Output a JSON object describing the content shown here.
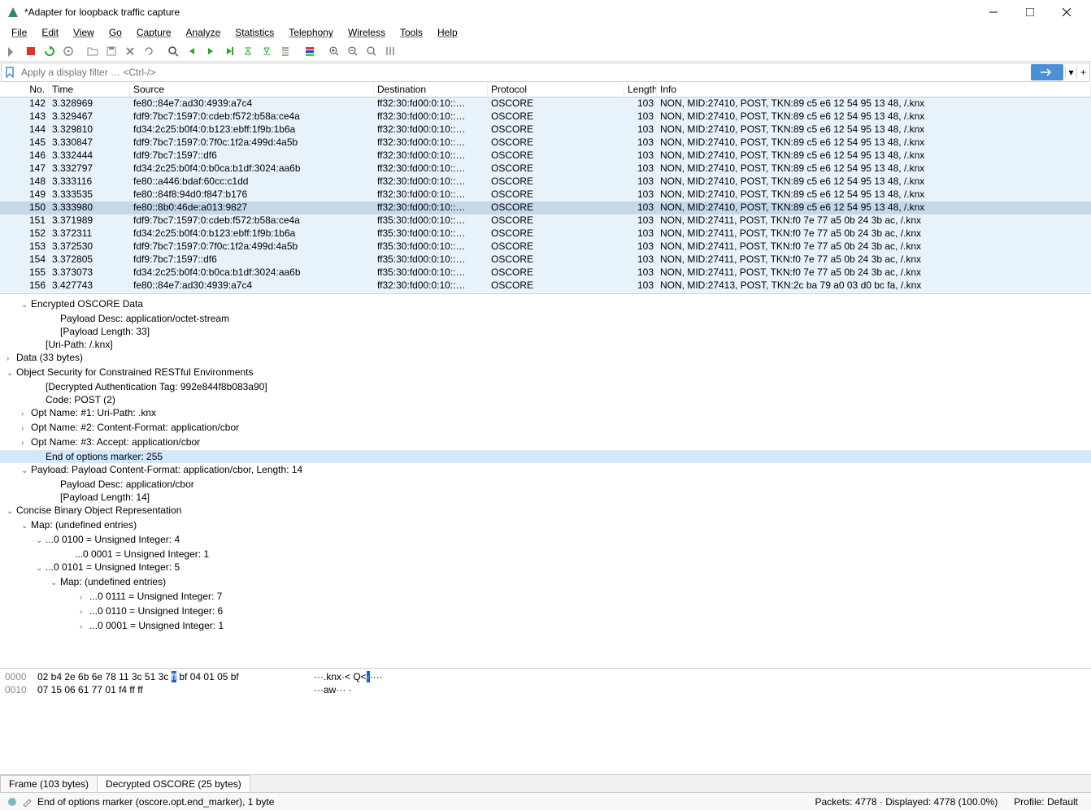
{
  "window": {
    "title": "*Adapter for loopback traffic capture"
  },
  "menu": {
    "file": "File",
    "edit": "Edit",
    "view": "View",
    "go": "Go",
    "capture": "Capture",
    "analyze": "Analyze",
    "statistics": "Statistics",
    "telephony": "Telephony",
    "wireless": "Wireless",
    "tools": "Tools",
    "help": "Help"
  },
  "filter": {
    "placeholder": "Apply a display filter … <Ctrl-/>"
  },
  "columns": {
    "no": "No.",
    "time": "Time",
    "source": "Source",
    "destination": "Destination",
    "protocol": "Protocol",
    "length": "Length",
    "info": "Info"
  },
  "packets": [
    {
      "no": "142",
      "time": "3.328969",
      "src": "fe80::84e7:ad30:4939:a7c4",
      "dst": "ff32:30:fd00:0:10::…",
      "proto": "OSCORE",
      "len": "103",
      "info": "NON, MID:27410, POST, TKN:89 c5 e6 12 54 95 13 48, /.knx"
    },
    {
      "no": "143",
      "time": "3.329467",
      "src": "fdf9:7bc7:1597:0:cdeb:f572:b58a:ce4a",
      "dst": "ff32:30:fd00:0:10::…",
      "proto": "OSCORE",
      "len": "103",
      "info": "NON, MID:27410, POST, TKN:89 c5 e6 12 54 95 13 48, /.knx"
    },
    {
      "no": "144",
      "time": "3.329810",
      "src": "fd34:2c25:b0f4:0:b123:ebff:1f9b:1b6a",
      "dst": "ff32:30:fd00:0:10::…",
      "proto": "OSCORE",
      "len": "103",
      "info": "NON, MID:27410, POST, TKN:89 c5 e6 12 54 95 13 48, /.knx"
    },
    {
      "no": "145",
      "time": "3.330847",
      "src": "fdf9:7bc7:1597:0:7f0c:1f2a:499d:4a5b",
      "dst": "ff32:30:fd00:0:10::…",
      "proto": "OSCORE",
      "len": "103",
      "info": "NON, MID:27410, POST, TKN:89 c5 e6 12 54 95 13 48, /.knx"
    },
    {
      "no": "146",
      "time": "3.332444",
      "src": "fdf9:7bc7:1597::df6",
      "dst": "ff32:30:fd00:0:10::…",
      "proto": "OSCORE",
      "len": "103",
      "info": "NON, MID:27410, POST, TKN:89 c5 e6 12 54 95 13 48, /.knx"
    },
    {
      "no": "147",
      "time": "3.332797",
      "src": "fd34:2c25:b0f4:0:b0ca:b1df:3024:aa6b",
      "dst": "ff32:30:fd00:0:10::…",
      "proto": "OSCORE",
      "len": "103",
      "info": "NON, MID:27410, POST, TKN:89 c5 e6 12 54 95 13 48, /.knx"
    },
    {
      "no": "148",
      "time": "3.333116",
      "src": "fe80::a446:bdaf:60cc:c1dd",
      "dst": "ff32:30:fd00:0:10::…",
      "proto": "OSCORE",
      "len": "103",
      "info": "NON, MID:27410, POST, TKN:89 c5 e6 12 54 95 13 48, /.knx"
    },
    {
      "no": "149",
      "time": "3.333535",
      "src": "fe80::84f8:94d0:f847:b176",
      "dst": "ff32:30:fd00:0:10::…",
      "proto": "OSCORE",
      "len": "103",
      "info": "NON, MID:27410, POST, TKN:89 c5 e6 12 54 95 13 48, /.knx"
    },
    {
      "no": "150",
      "time": "3.333980",
      "src": "fe80::8b0:46de:a013:9827",
      "dst": "ff32:30:fd00:0:10::…",
      "proto": "OSCORE",
      "len": "103",
      "info": "NON, MID:27410, POST, TKN:89 c5 e6 12 54 95 13 48, /.knx",
      "selected": true
    },
    {
      "no": "151",
      "time": "3.371989",
      "src": "fdf9:7bc7:1597:0:cdeb:f572:b58a:ce4a",
      "dst": "ff35:30:fd00:0:10::…",
      "proto": "OSCORE",
      "len": "103",
      "info": "NON, MID:27411, POST, TKN:f0 7e 77 a5 0b 24 3b ac, /.knx"
    },
    {
      "no": "152",
      "time": "3.372311",
      "src": "fd34:2c25:b0f4:0:b123:ebff:1f9b:1b6a",
      "dst": "ff35:30:fd00:0:10::…",
      "proto": "OSCORE",
      "len": "103",
      "info": "NON, MID:27411, POST, TKN:f0 7e 77 a5 0b 24 3b ac, /.knx"
    },
    {
      "no": "153",
      "time": "3.372530",
      "src": "fdf9:7bc7:1597:0:7f0c:1f2a:499d:4a5b",
      "dst": "ff35:30:fd00:0:10::…",
      "proto": "OSCORE",
      "len": "103",
      "info": "NON, MID:27411, POST, TKN:f0 7e 77 a5 0b 24 3b ac, /.knx"
    },
    {
      "no": "154",
      "time": "3.372805",
      "src": "fdf9:7bc7:1597::df6",
      "dst": "ff35:30:fd00:0:10::…",
      "proto": "OSCORE",
      "len": "103",
      "info": "NON, MID:27411, POST, TKN:f0 7e 77 a5 0b 24 3b ac, /.knx"
    },
    {
      "no": "155",
      "time": "3.373073",
      "src": "fd34:2c25:b0f4:0:b0ca:b1df:3024:aa6b",
      "dst": "ff35:30:fd00:0:10::…",
      "proto": "OSCORE",
      "len": "103",
      "info": "NON, MID:27411, POST, TKN:f0 7e 77 a5 0b 24 3b ac, /.knx"
    },
    {
      "no": "156",
      "time": "3.427743",
      "src": "fe80::84e7:ad30:4939:a7c4",
      "dst": "ff32:30:fd00:0:10::…",
      "proto": "OSCORE",
      "len": "103",
      "info": "NON, MID:27413, POST, TKN:2c ba 79 a0 03 d0 bc fa, /.knx"
    }
  ],
  "details": [
    {
      "indent": 1,
      "toggle": "v",
      "text": "Encrypted OSCORE Data"
    },
    {
      "indent": 3,
      "toggle": "",
      "text": "Payload Desc: application/octet-stream"
    },
    {
      "indent": 3,
      "toggle": "",
      "text": "[Payload Length: 33]"
    },
    {
      "indent": 2,
      "toggle": "",
      "text": "[Uri-Path: /.knx]"
    },
    {
      "indent": 0,
      "toggle": ">",
      "text": "Data (33 bytes)"
    },
    {
      "indent": 0,
      "toggle": "v",
      "text": "Object Security for Constrained RESTful Environments"
    },
    {
      "indent": 2,
      "toggle": "",
      "text": "[Decrypted Authentication Tag: 992e844f8b083a90]"
    },
    {
      "indent": 2,
      "toggle": "",
      "text": "Code: POST (2)"
    },
    {
      "indent": 1,
      "toggle": ">",
      "text": "Opt Name: #1: Uri-Path: .knx"
    },
    {
      "indent": 1,
      "toggle": ">",
      "text": "Opt Name: #2: Content-Format: application/cbor"
    },
    {
      "indent": 1,
      "toggle": ">",
      "text": "Opt Name: #3: Accept: application/cbor"
    },
    {
      "indent": 2,
      "toggle": "",
      "text": "End of options marker: 255",
      "hl": true
    },
    {
      "indent": 1,
      "toggle": "v",
      "text": "Payload: Payload Content-Format: application/cbor, Length: 14"
    },
    {
      "indent": 3,
      "toggle": "",
      "text": "Payload Desc: application/cbor"
    },
    {
      "indent": 3,
      "toggle": "",
      "text": "[Payload Length: 14]"
    },
    {
      "indent": 0,
      "toggle": "v",
      "text": "Concise Binary Object Representation"
    },
    {
      "indent": 1,
      "toggle": "v",
      "text": "Map: (undefined entries)"
    },
    {
      "indent": 2,
      "toggle": "v",
      "text": "...0 0100 = Unsigned Integer: 4"
    },
    {
      "indent": 4,
      "toggle": "",
      "text": "...0 0001 = Unsigned Integer: 1"
    },
    {
      "indent": 2,
      "toggle": "v",
      "text": "...0 0101 = Unsigned Integer: 5"
    },
    {
      "indent": 3,
      "toggle": "v",
      "text": "Map: (undefined entries)"
    },
    {
      "indent": 5,
      "toggle": ">",
      "text": "...0 0111 = Unsigned Integer: 7"
    },
    {
      "indent": 5,
      "toggle": ">",
      "text": "...0 0110 = Unsigned Integer: 6"
    },
    {
      "indent": 5,
      "toggle": ">",
      "text": "...0 0001 = Unsigned Integer: 1"
    }
  ],
  "hex": {
    "rows": [
      {
        "offset": "0000",
        "bytes_pre": "02 b4 2e 6b 6e 78 11 3c  51 3c ",
        "bytes_hl": "ff",
        "bytes_post": " bf 04 01 05 bf",
        "ascii_pre": "···.knx·< Q<",
        "ascii_hl": "·",
        "ascii_post": "····"
      },
      {
        "offset": "0010",
        "bytes_pre": "07 15 06 61 77 01 f4 ff  ff",
        "bytes_hl": "",
        "bytes_post": "",
        "ascii_pre": "···aw··· ·",
        "ascii_hl": "",
        "ascii_post": ""
      }
    ]
  },
  "bottomtabs": {
    "frame": "Frame (103 bytes)",
    "decrypted": "Decrypted OSCORE (25 bytes)"
  },
  "status": {
    "field": "End of options marker (oscore.opt.end_marker), 1 byte",
    "count": "Packets: 4778 · Displayed: 4778 (100.0%)",
    "profile": "Profile: Default"
  }
}
